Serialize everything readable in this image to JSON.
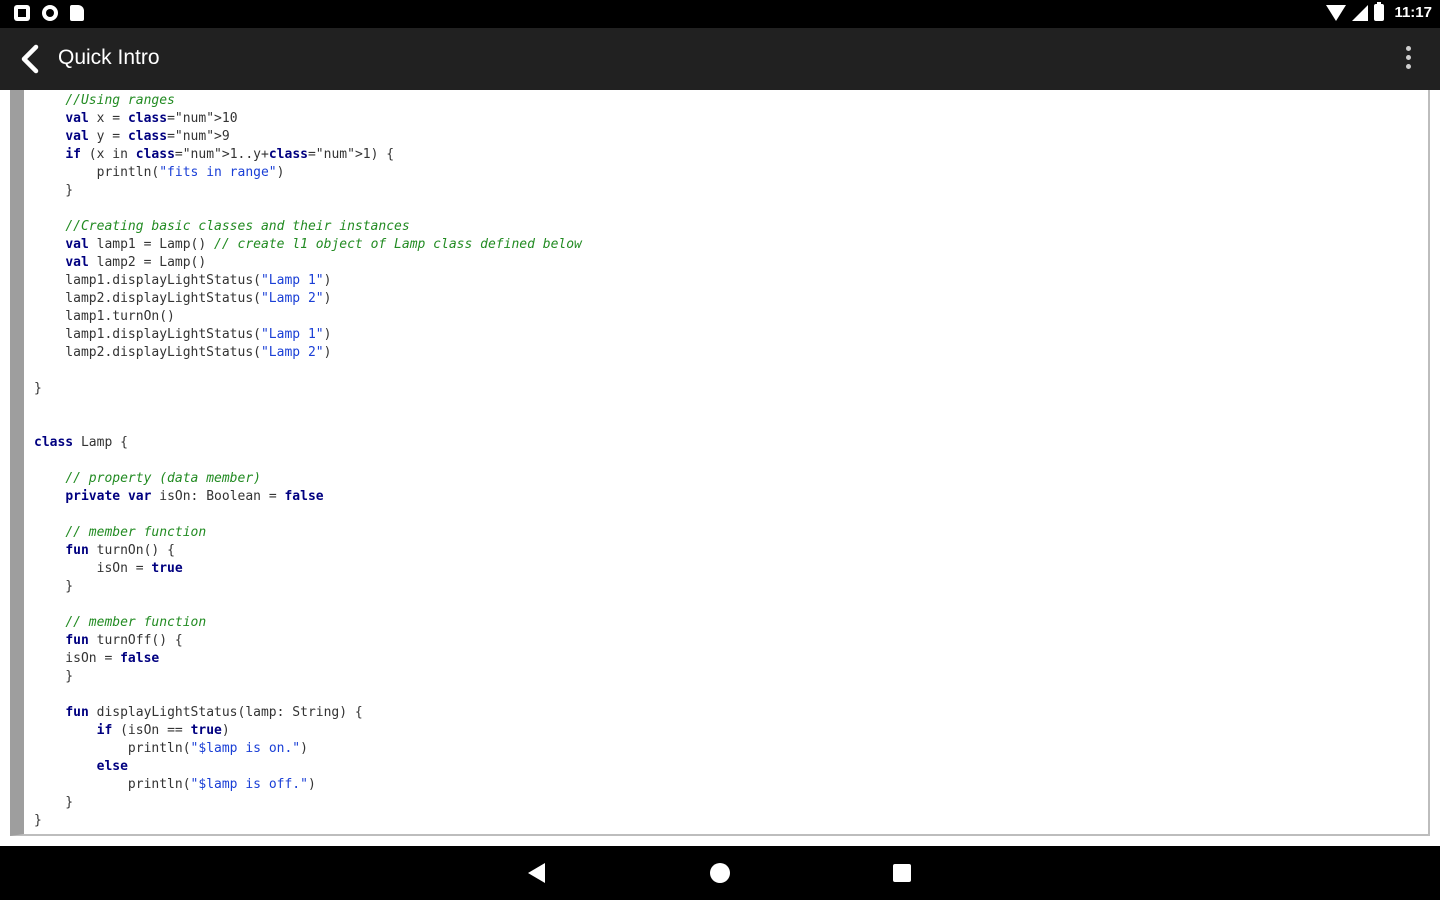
{
  "status_bar": {
    "time": "11:17",
    "left_icons": [
      "notification-app-icon",
      "notification-circle-icon",
      "sd-card-icon"
    ],
    "right_icons": [
      "wifi-icon",
      "cellular-signal-icon",
      "battery-icon"
    ]
  },
  "app_bar": {
    "title": "Quick Intro",
    "back_icon": "back-arrow-icon",
    "menu_icon": "overflow-menu-icon"
  },
  "code": {
    "language": "kotlin",
    "lines": [
      "    //Using ranges",
      "    val x = 10",
      "    val y = 9",
      "    if (x in 1..y+1) {",
      "        println(\"fits in range\")",
      "    }",
      "",
      "    //Creating basic classes and their instances",
      "    val lamp1 = Lamp() // create l1 object of Lamp class defined below",
      "    val lamp2 = Lamp()",
      "    lamp1.displayLightStatus(\"Lamp 1\")",
      "    lamp2.displayLightStatus(\"Lamp 2\")",
      "    lamp1.turnOn()",
      "    lamp1.displayLightStatus(\"Lamp 1\")",
      "    lamp2.displayLightStatus(\"Lamp 2\")",
      "",
      "}",
      "",
      "",
      "class Lamp {",
      "",
      "    // property (data member)",
      "    private var isOn: Boolean = false",
      "",
      "    // member function",
      "    fun turnOn() {",
      "        isOn = true",
      "    }",
      "",
      "    // member function",
      "    fun turnOff() {",
      "    isOn = false",
      "    }",
      "",
      "    fun displayLightStatus(lamp: String) {",
      "        if (isOn == true)",
      "            println(\"$lamp is on.\")",
      "        else",
      "            println(\"$lamp is off.\")",
      "    }",
      "}"
    ]
  },
  "nav_bar": {
    "buttons": [
      "nav-back-icon",
      "nav-home-icon",
      "nav-recents-icon"
    ]
  },
  "colors": {
    "status_bar_bg": "#000000",
    "app_bar_bg": "#212121",
    "keyword": "#000080",
    "comment": "#228b22",
    "string": "#1a3fd6",
    "left_border": "#9e9e9e"
  }
}
